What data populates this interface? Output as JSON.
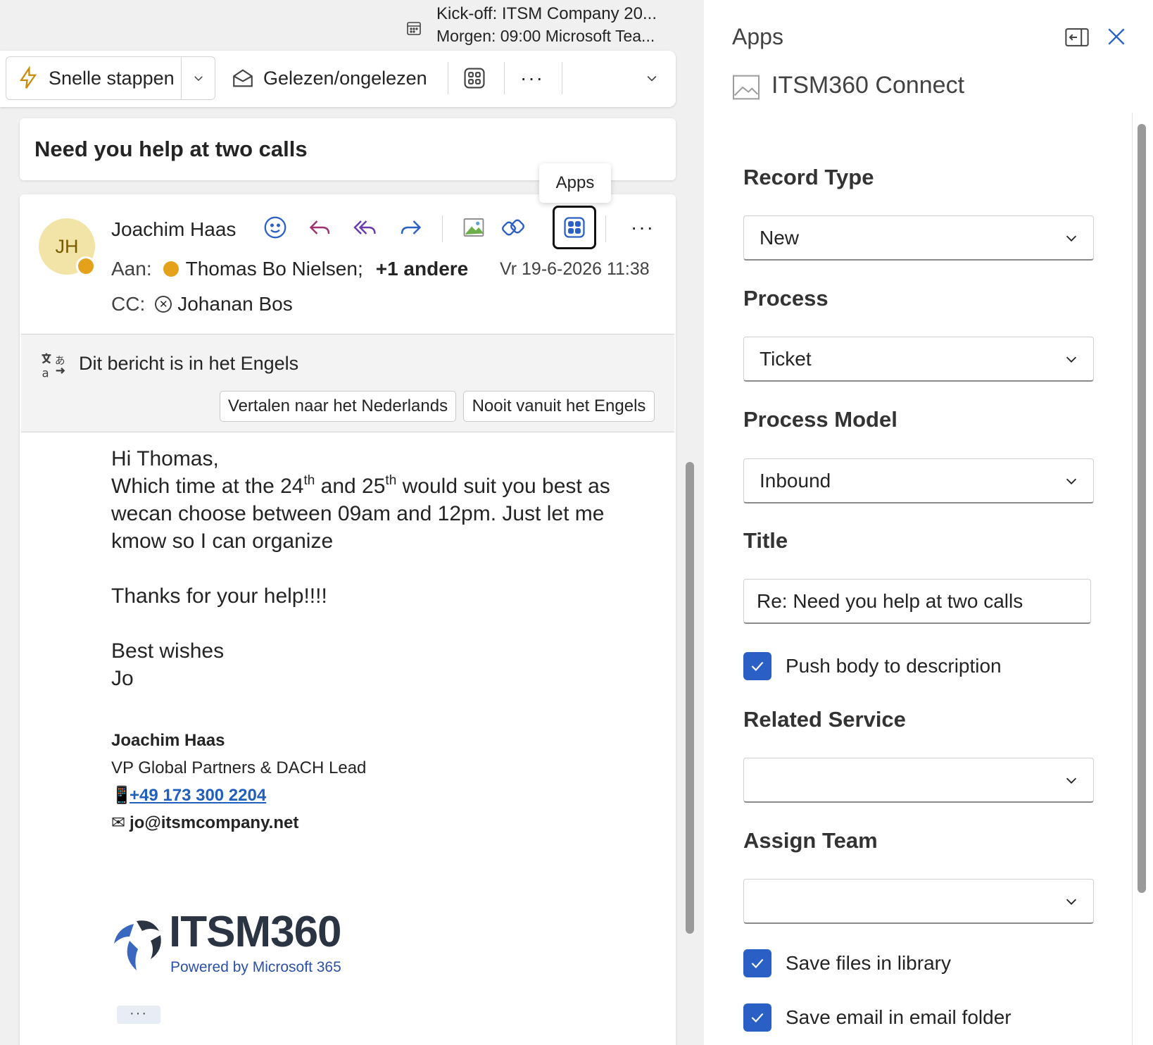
{
  "reminder": {
    "title": "Kick-off: ITSM Company 20...",
    "detail": "Morgen: 09:00 Microsoft Tea..."
  },
  "toolbar": {
    "quick_steps_label": "Snelle stappen",
    "read_unread_label": "Gelezen/ongelezen",
    "more_label": "···"
  },
  "email": {
    "subject": "Need you help at two calls",
    "sender_initials": "JH",
    "sender_name": "Joachim Haas",
    "to_label": "Aan:",
    "to_name": "Thomas Bo Nielsen;",
    "to_more": "+1 andere",
    "date": "Vr 19-6-2026 11:38",
    "cc_label": "CC:",
    "cc_name": "Johanan Bos",
    "apps_tooltip": "Apps",
    "more_label": "···"
  },
  "translate": {
    "notice": "Dit bericht is in het Engels",
    "translate_button": "Vertalen naar het Nederlands",
    "never_button": "Nooit vanuit het Engels"
  },
  "body": {
    "greeting": "Hi Thomas,",
    "line1_a": "Which time at the 24",
    "line1_sup1": "th",
    "line1_b": " and 25",
    "line1_sup2": "th",
    "line1_c": " would suit you best as wecan choose between 09am and 12pm. Just let me kmow so I can organize",
    "thanks": "Thanks for your help!!!!",
    "closing": "Best wishes",
    "signoff": "Jo"
  },
  "signature": {
    "name": "Joachim Haas",
    "role": "VP Global Partners & DACH Lead",
    "phone": "+49 173 300 2204",
    "email": "jo@itsmcompany.net",
    "logo_word": "ITSM360",
    "logo_tagline": "Powered by Microsoft 365",
    "expand_label": "···"
  },
  "apps_pane": {
    "title": "Apps",
    "addin_name": "ITSM360 Connect",
    "fields": {
      "record_type_label": "Record Type",
      "record_type_value": "New",
      "process_label": "Process",
      "process_value": "Ticket",
      "process_model_label": "Process Model",
      "process_model_value": "Inbound",
      "title_label": "Title",
      "title_value": "Re: Need you help at two calls",
      "push_body_label": "Push body to description",
      "push_body_checked": true,
      "related_service_label": "Related Service",
      "related_service_value": "",
      "assign_team_label": "Assign Team",
      "assign_team_value": "",
      "save_files_label": "Save files in library",
      "save_files_checked": true,
      "save_email_label": "Save email in email folder",
      "save_email_checked": true
    }
  },
  "colors": {
    "accent": "#2a60c5",
    "avatar_bg": "#f2e4a6",
    "presence_away": "#e3a21a",
    "link": "#1f5fbf"
  }
}
